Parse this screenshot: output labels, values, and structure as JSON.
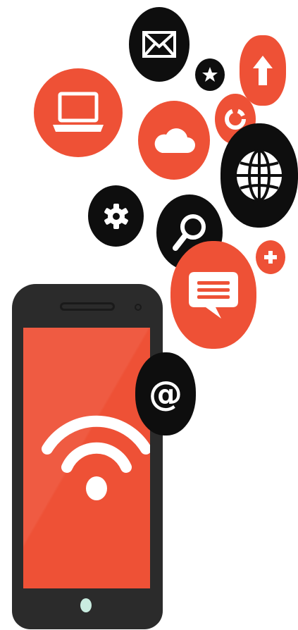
{
  "illustration": {
    "accent_color": "#ee5136",
    "dark_color": "#0e0e0e",
    "phone_body_color": "#2b2b2b",
    "home_button_color": "#c9ece0",
    "icons": [
      {
        "name": "laptop-icon",
        "bubble_color": "red"
      },
      {
        "name": "cloud-icon",
        "bubble_color": "red"
      },
      {
        "name": "mail-icon",
        "bubble_color": "black"
      },
      {
        "name": "star-icon",
        "bubble_color": "black"
      },
      {
        "name": "upload-arrow-icon",
        "bubble_color": "red"
      },
      {
        "name": "refresh-icon",
        "bubble_color": "red"
      },
      {
        "name": "globe-icon",
        "bubble_color": "black"
      },
      {
        "name": "gear-icon",
        "bubble_color": "black"
      },
      {
        "name": "search-icon",
        "bubble_color": "black"
      },
      {
        "name": "plus-icon",
        "bubble_color": "red"
      },
      {
        "name": "chat-icon",
        "bubble_color": "red"
      },
      {
        "name": "at-sign-icon",
        "bubble_color": "black"
      },
      {
        "name": "wifi-icon",
        "bubble_color": "none"
      }
    ],
    "at_symbol": "@"
  }
}
